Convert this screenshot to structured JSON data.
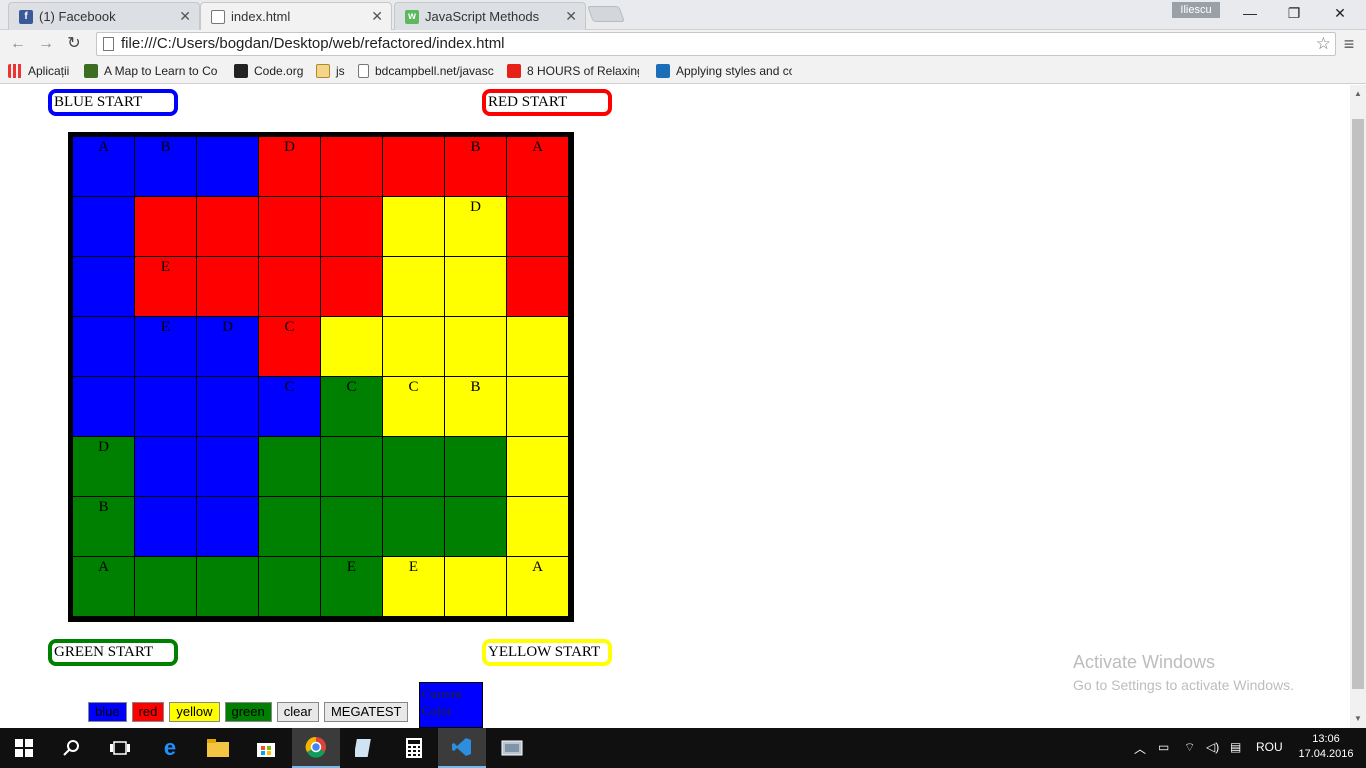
{
  "browser": {
    "tabs": [
      {
        "title": "(1) Facebook",
        "icon": "facebook-icon",
        "active": false
      },
      {
        "title": "index.html",
        "icon": "document-icon",
        "active": true
      },
      {
        "title": "JavaScript Methods",
        "icon": "w3schools-icon",
        "active": false
      }
    ],
    "user": "Iliescu",
    "url": "file:///C:/Users/bogdan/Desktop/web/refactored/index.html",
    "bookmarks": [
      {
        "label": "Aplicații",
        "icon": "apps-icon"
      },
      {
        "label": "A Map to Learn to Co",
        "icon": "map-icon"
      },
      {
        "label": "Code.org",
        "icon": "codeorg-icon"
      },
      {
        "label": "js",
        "icon": "folder-icon"
      },
      {
        "label": "bdcampbell.net/javasc",
        "icon": "page-icon"
      },
      {
        "label": "8 HOURS of Relaxing",
        "icon": "youtube-icon"
      },
      {
        "label": "Applying styles and co",
        "icon": "bookmark-icon"
      }
    ]
  },
  "page": {
    "starts": {
      "blue": "BLUE START",
      "red": "RED START",
      "green": "GREEN START",
      "yellow": "YELLOW START"
    },
    "colors": {
      "blue": "#0000ff",
      "red": "#ff0000",
      "yellow": "#ffff00",
      "green": "#008000"
    },
    "board": [
      [
        {
          "c": "blue",
          "t": "A"
        },
        {
          "c": "blue",
          "t": "B"
        },
        {
          "c": "blue",
          "t": ""
        },
        {
          "c": "red",
          "t": "D"
        },
        {
          "c": "red",
          "t": ""
        },
        {
          "c": "red",
          "t": ""
        },
        {
          "c": "red",
          "t": "B"
        },
        {
          "c": "red",
          "t": "A"
        }
      ],
      [
        {
          "c": "blue",
          "t": ""
        },
        {
          "c": "red",
          "t": ""
        },
        {
          "c": "red",
          "t": ""
        },
        {
          "c": "red",
          "t": ""
        },
        {
          "c": "red",
          "t": ""
        },
        {
          "c": "yellow",
          "t": ""
        },
        {
          "c": "yellow",
          "t": "D"
        },
        {
          "c": "red",
          "t": ""
        }
      ],
      [
        {
          "c": "blue",
          "t": ""
        },
        {
          "c": "red",
          "t": "E"
        },
        {
          "c": "red",
          "t": ""
        },
        {
          "c": "red",
          "t": ""
        },
        {
          "c": "red",
          "t": ""
        },
        {
          "c": "yellow",
          "t": ""
        },
        {
          "c": "yellow",
          "t": ""
        },
        {
          "c": "red",
          "t": ""
        }
      ],
      [
        {
          "c": "blue",
          "t": ""
        },
        {
          "c": "blue",
          "t": "E"
        },
        {
          "c": "blue",
          "t": "D"
        },
        {
          "c": "red",
          "t": "C"
        },
        {
          "c": "yellow",
          "t": ""
        },
        {
          "c": "yellow",
          "t": ""
        },
        {
          "c": "yellow",
          "t": ""
        },
        {
          "c": "yellow",
          "t": ""
        }
      ],
      [
        {
          "c": "blue",
          "t": ""
        },
        {
          "c": "blue",
          "t": ""
        },
        {
          "c": "blue",
          "t": ""
        },
        {
          "c": "blue",
          "t": "C"
        },
        {
          "c": "green",
          "t": "C"
        },
        {
          "c": "yellow",
          "t": "C"
        },
        {
          "c": "yellow",
          "t": "B"
        },
        {
          "c": "yellow",
          "t": ""
        }
      ],
      [
        {
          "c": "green",
          "t": "D"
        },
        {
          "c": "blue",
          "t": ""
        },
        {
          "c": "blue",
          "t": ""
        },
        {
          "c": "green",
          "t": ""
        },
        {
          "c": "green",
          "t": ""
        },
        {
          "c": "green",
          "t": ""
        },
        {
          "c": "green",
          "t": ""
        },
        {
          "c": "yellow",
          "t": ""
        }
      ],
      [
        {
          "c": "green",
          "t": "B"
        },
        {
          "c": "blue",
          "t": ""
        },
        {
          "c": "blue",
          "t": ""
        },
        {
          "c": "green",
          "t": ""
        },
        {
          "c": "green",
          "t": ""
        },
        {
          "c": "green",
          "t": ""
        },
        {
          "c": "green",
          "t": ""
        },
        {
          "c": "yellow",
          "t": ""
        }
      ],
      [
        {
          "c": "green",
          "t": "A"
        },
        {
          "c": "green",
          "t": ""
        },
        {
          "c": "green",
          "t": ""
        },
        {
          "c": "green",
          "t": ""
        },
        {
          "c": "green",
          "t": "E"
        },
        {
          "c": "yellow",
          "t": "E"
        },
        {
          "c": "yellow",
          "t": ""
        },
        {
          "c": "yellow",
          "t": "A"
        }
      ]
    ],
    "palette": [
      {
        "label": "blue",
        "color": "blue"
      },
      {
        "label": "red",
        "color": "red"
      },
      {
        "label": "yellow",
        "color": "yellow"
      },
      {
        "label": "green",
        "color": "green"
      },
      {
        "label": "clear",
        "color": null
      },
      {
        "label": "MEGATEST",
        "color": null
      }
    ],
    "current_color_label": "Current Color",
    "current_color": "blue"
  },
  "watermark": {
    "line1": "Activate Windows",
    "line2": "Go to Settings to activate Windows."
  },
  "taskbar": {
    "lang": "ROU",
    "time": "13:06",
    "date": "17.04.2016"
  }
}
